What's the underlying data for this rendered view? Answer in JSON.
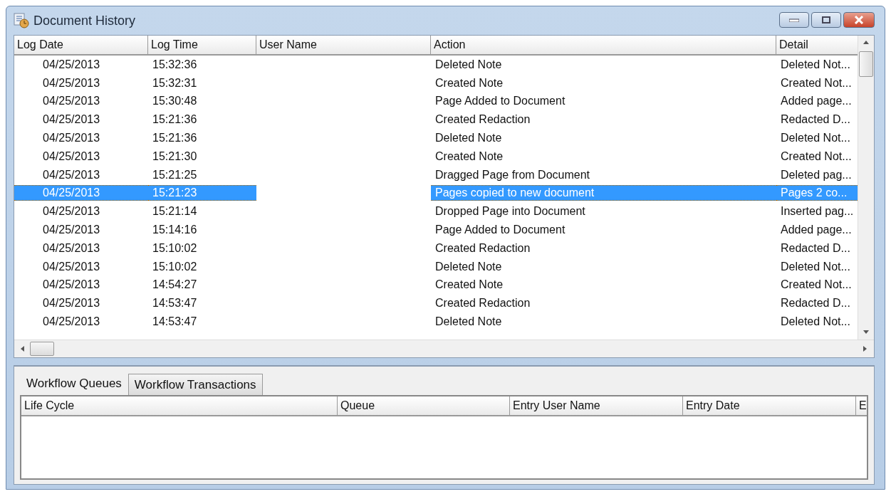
{
  "window": {
    "title": "Document History"
  },
  "history": {
    "columns": [
      "Log Date",
      "Log Time",
      "User Name",
      "Action",
      "Detail"
    ],
    "rows": [
      {
        "date": "04/25/2013",
        "time": "15:32:36",
        "action": "Deleted Note",
        "detail": "Deleted Not...",
        "selected": false
      },
      {
        "date": "04/25/2013",
        "time": "15:32:31",
        "action": "Created Note",
        "detail": "Created Not...",
        "selected": false
      },
      {
        "date": "04/25/2013",
        "time": "15:30:48",
        "action": "Page Added to Document",
        "detail": "Added page...",
        "selected": false
      },
      {
        "date": "04/25/2013",
        "time": "15:21:36",
        "action": "Created Redaction",
        "detail": "Redacted D...",
        "selected": false
      },
      {
        "date": "04/25/2013",
        "time": "15:21:36",
        "action": "Deleted Note",
        "detail": "Deleted Not...",
        "selected": false
      },
      {
        "date": "04/25/2013",
        "time": "15:21:30",
        "action": "Created Note",
        "detail": "Created Not...",
        "selected": false
      },
      {
        "date": "04/25/2013",
        "time": "15:21:25",
        "action": "Dragged Page from Document",
        "detail": "Deleted pag...",
        "selected": false
      },
      {
        "date": "04/25/2013",
        "time": "15:21:23",
        "action": "Pages copied to new document",
        "detail": "Pages 2 co...",
        "selected": true
      },
      {
        "date": "04/25/2013",
        "time": "15:21:14",
        "action": "Dropped Page into Document",
        "detail": "Inserted pag...",
        "selected": false
      },
      {
        "date": "04/25/2013",
        "time": "15:14:16",
        "action": "Page Added to Document",
        "detail": "Added page...",
        "selected": false
      },
      {
        "date": "04/25/2013",
        "time": "15:10:02",
        "action": "Created Redaction",
        "detail": "Redacted D...",
        "selected": false
      },
      {
        "date": "04/25/2013",
        "time": "15:10:02",
        "action": "Deleted Note",
        "detail": "Deleted Not...",
        "selected": false
      },
      {
        "date": "04/25/2013",
        "time": "14:54:27",
        "action": "Created Note",
        "detail": "Created Not...",
        "selected": false
      },
      {
        "date": "04/25/2013",
        "time": "14:53:47",
        "action": "Created Redaction",
        "detail": "Redacted D...",
        "selected": false
      },
      {
        "date": "04/25/2013",
        "time": "14:53:47",
        "action": "Deleted Note",
        "detail": "Deleted Not...",
        "selected": false
      }
    ]
  },
  "tabs": [
    {
      "label": "Workflow Queues",
      "selected": true
    },
    {
      "label": "Workflow Transactions",
      "selected": false
    }
  ],
  "queues": {
    "columns": [
      "Life Cycle",
      "Queue",
      "Entry User Name",
      "Entry Date",
      "E"
    ]
  }
}
